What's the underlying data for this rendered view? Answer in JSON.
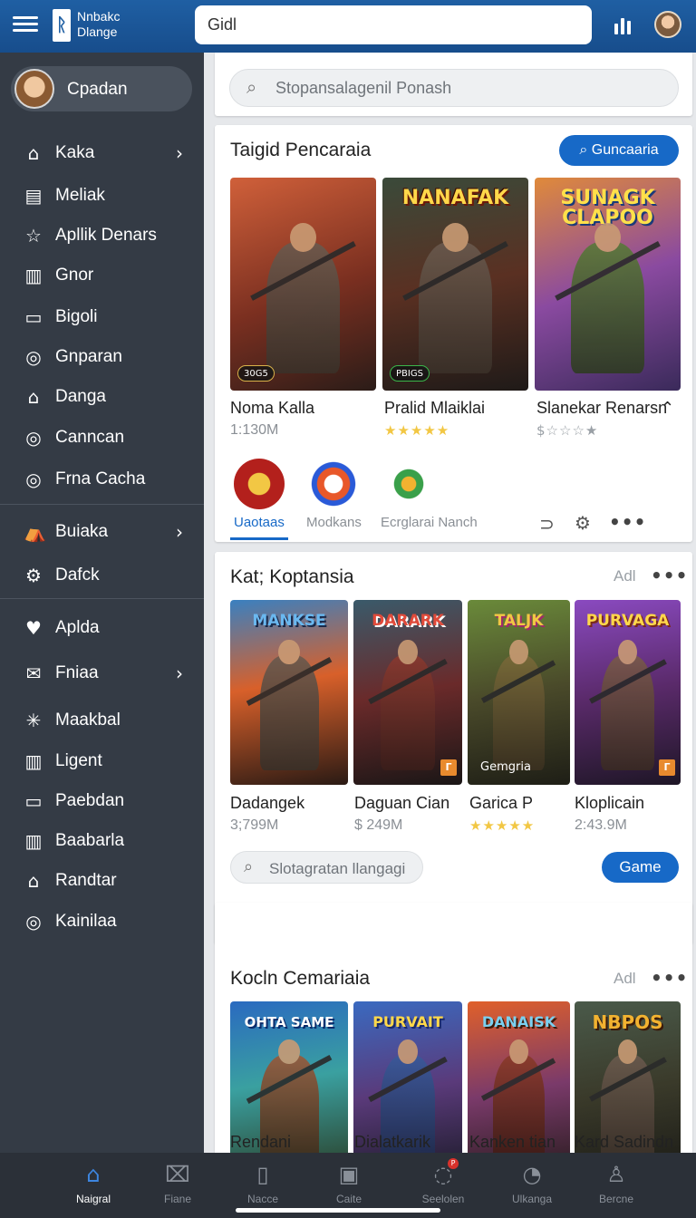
{
  "topbar": {
    "brand_line1": "Nnbakc",
    "brand_line2": "Dlange",
    "search_value": "Gidl"
  },
  "sidebar": {
    "profile_name": "Cpadan",
    "items": [
      {
        "label": "Kaka",
        "icon": "home-icon",
        "chevron": true
      },
      {
        "label": "Meliak",
        "icon": "calendar-icon"
      },
      {
        "label": "Apllik Denars",
        "icon": "star-icon"
      },
      {
        "label": "Gnor",
        "icon": "chart-icon"
      },
      {
        "label": "Bigoli",
        "icon": "monitor-icon"
      },
      {
        "label": "Gnparan",
        "icon": "compass-icon"
      },
      {
        "label": "Danga",
        "icon": "house-icon"
      },
      {
        "label": "Canncan",
        "icon": "compass-icon"
      },
      {
        "label": "Frna Cacha",
        "icon": "compass-icon"
      },
      {
        "label": "Buiaka",
        "icon": "tent-icon",
        "chevron": true
      },
      {
        "label": "Dafck",
        "icon": "gear-icon"
      },
      {
        "label": "Aplda",
        "icon": "heart-icon"
      },
      {
        "label": "Fniaa",
        "icon": "mail-icon",
        "chevron": true
      },
      {
        "label": "Maakbal",
        "icon": "sparkle-icon"
      },
      {
        "label": "Ligent",
        "icon": "chart-icon"
      },
      {
        "label": "Paebdan",
        "icon": "tablet-icon"
      },
      {
        "label": "Baabarla",
        "icon": "chart-icon"
      },
      {
        "label": "Randtar",
        "icon": "house-icon"
      },
      {
        "label": "Kainilaa",
        "icon": "compass-icon"
      }
    ]
  },
  "search_card": {
    "placeholder": "Stopansalagenil Ponash"
  },
  "section1": {
    "title": "Taigid Pencaraia",
    "button": "Guncaaria",
    "games": [
      {
        "title_art": "",
        "name": "Noma Kalla",
        "sub": "1:130M",
        "badge": "30G5"
      },
      {
        "title_art": "NANAFAK",
        "name": "Pralid Mlaiklai",
        "stars": "★★★★★",
        "badge": "PBIGS"
      },
      {
        "title_art": "SUNAGK CLAPOO",
        "name": "Slanekar Renarsn",
        "stars": "$☆☆☆★",
        "badge": ""
      }
    ],
    "tabs": [
      "Uaotaas",
      "Modkans",
      "Ecrglarai Nanch"
    ]
  },
  "section2": {
    "title": "Kat; Koptansia",
    "more": "Adl",
    "games": [
      {
        "title_art": "MANKSE",
        "name": "Dadangek",
        "sub": "3;799M"
      },
      {
        "title_art": "DARARK",
        "name": "Daguan Cian",
        "sub": "$ 249M"
      },
      {
        "title_art": "TALJK",
        "name": "Garica P",
        "stars": "★★★★★",
        "badge": "Gemgria"
      },
      {
        "title_art": "PURVAGA",
        "name": "Kloplicain",
        "sub": "2:43.9M"
      }
    ],
    "search_placeholder": "Slotagratan llangagi",
    "button": "Game"
  },
  "section3": {
    "title": "Kocln Cemariaia",
    "more": "Adl",
    "games": [
      {
        "title_art": "OHTA SAME",
        "name": "Rendani"
      },
      {
        "title_art": "PURVAIT",
        "name": "Dialatkarik"
      },
      {
        "title_art": "DANAISK",
        "name": "Kanken tian"
      },
      {
        "title_art": "NBPOS",
        "name": "Kard Sadindn"
      }
    ]
  },
  "bottom_nav": [
    {
      "label": "Naigral",
      "icon": "home-icon",
      "active": true
    },
    {
      "label": "Fiane",
      "icon": "ticket-icon"
    },
    {
      "label": "Nacce",
      "icon": "book-icon"
    },
    {
      "label": "Caite",
      "icon": "store-icon"
    },
    {
      "label": "Seelolen",
      "icon": "chat-icon"
    },
    {
      "label": "Ulkanga",
      "icon": "support-icon"
    },
    {
      "label": "Bercne",
      "icon": "user-icon"
    }
  ],
  "colors": {
    "topbar": "#1f5fa3",
    "sidebar": "#343b45",
    "accent": "#1769c7"
  }
}
